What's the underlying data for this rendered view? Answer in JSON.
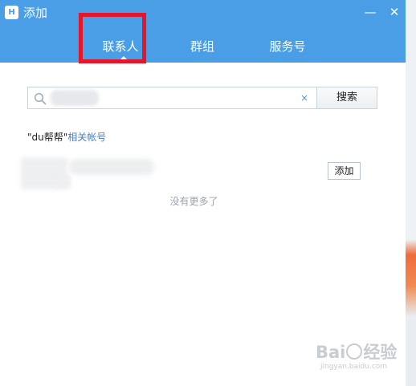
{
  "window": {
    "title": "添加",
    "logo_text": "H",
    "minimize_symbol": "—",
    "close_symbol": "✕"
  },
  "tabs": [
    {
      "label": "联系人",
      "active": true
    },
    {
      "label": "群组",
      "active": false
    },
    {
      "label": "服务号",
      "active": false
    }
  ],
  "search": {
    "value": "",
    "placeholder": "",
    "clear_symbol": "×",
    "button_label": "搜索"
  },
  "results": {
    "label_keyword": "\"du帮帮\"",
    "label_suffix": "相关帐号",
    "items": [
      {
        "add_label": "添加"
      }
    ],
    "end_text": "没有更多了"
  },
  "watermark": {
    "brand_left": "Bai",
    "brand_right": "经验",
    "domain": "jingyan.baidu.com"
  },
  "colors": {
    "header": "#4a9ee6",
    "highlight": "#e5162a",
    "link": "#4a7fb8"
  }
}
